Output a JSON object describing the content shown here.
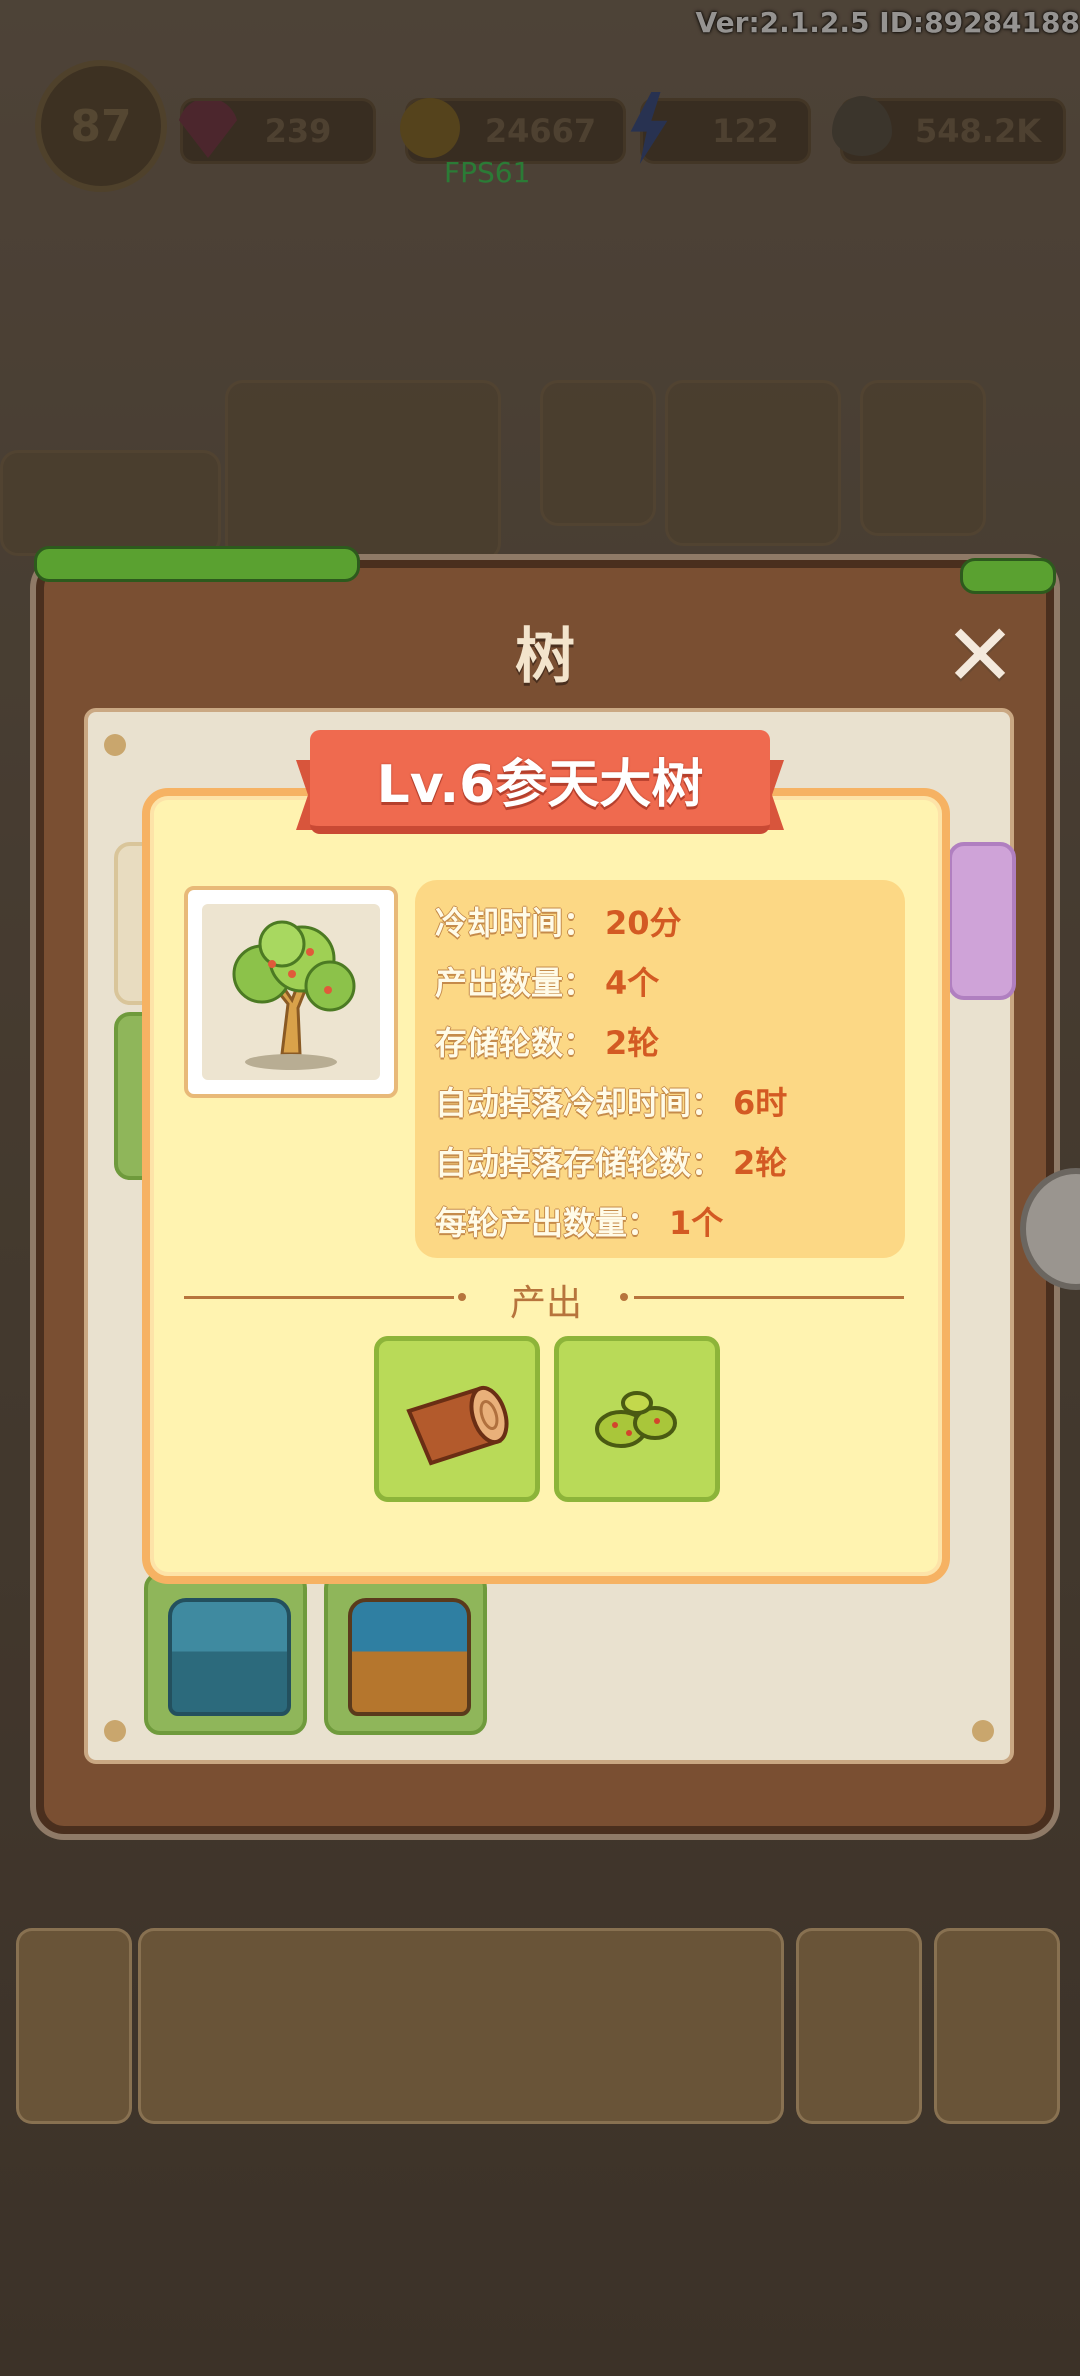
{
  "hud": {
    "version": "Ver:2.1.2.5 ID:89284188",
    "fps": "FPS61",
    "level": "87",
    "gems": "239",
    "coins": "24667",
    "energy": "122",
    "seeds": "548.2K"
  },
  "panel": {
    "title": "树",
    "close_icon": "✕"
  },
  "popup": {
    "item_title": "Lv.6参天大树",
    "stats": [
      {
        "key": "冷却时间：",
        "value": "20分"
      },
      {
        "key": "产出数量：",
        "value": "4个"
      },
      {
        "key": "存储轮数：",
        "value": "2轮"
      },
      {
        "key": "自动掉落冷却时间：",
        "value": "6时"
      },
      {
        "key": "自动掉落存储轮数：",
        "value": "2轮"
      },
      {
        "key": "每轮产出数量：",
        "value": "1个"
      }
    ],
    "output_label": "产出",
    "outputs": [
      "wood-log-icon",
      "olive-icon"
    ]
  }
}
